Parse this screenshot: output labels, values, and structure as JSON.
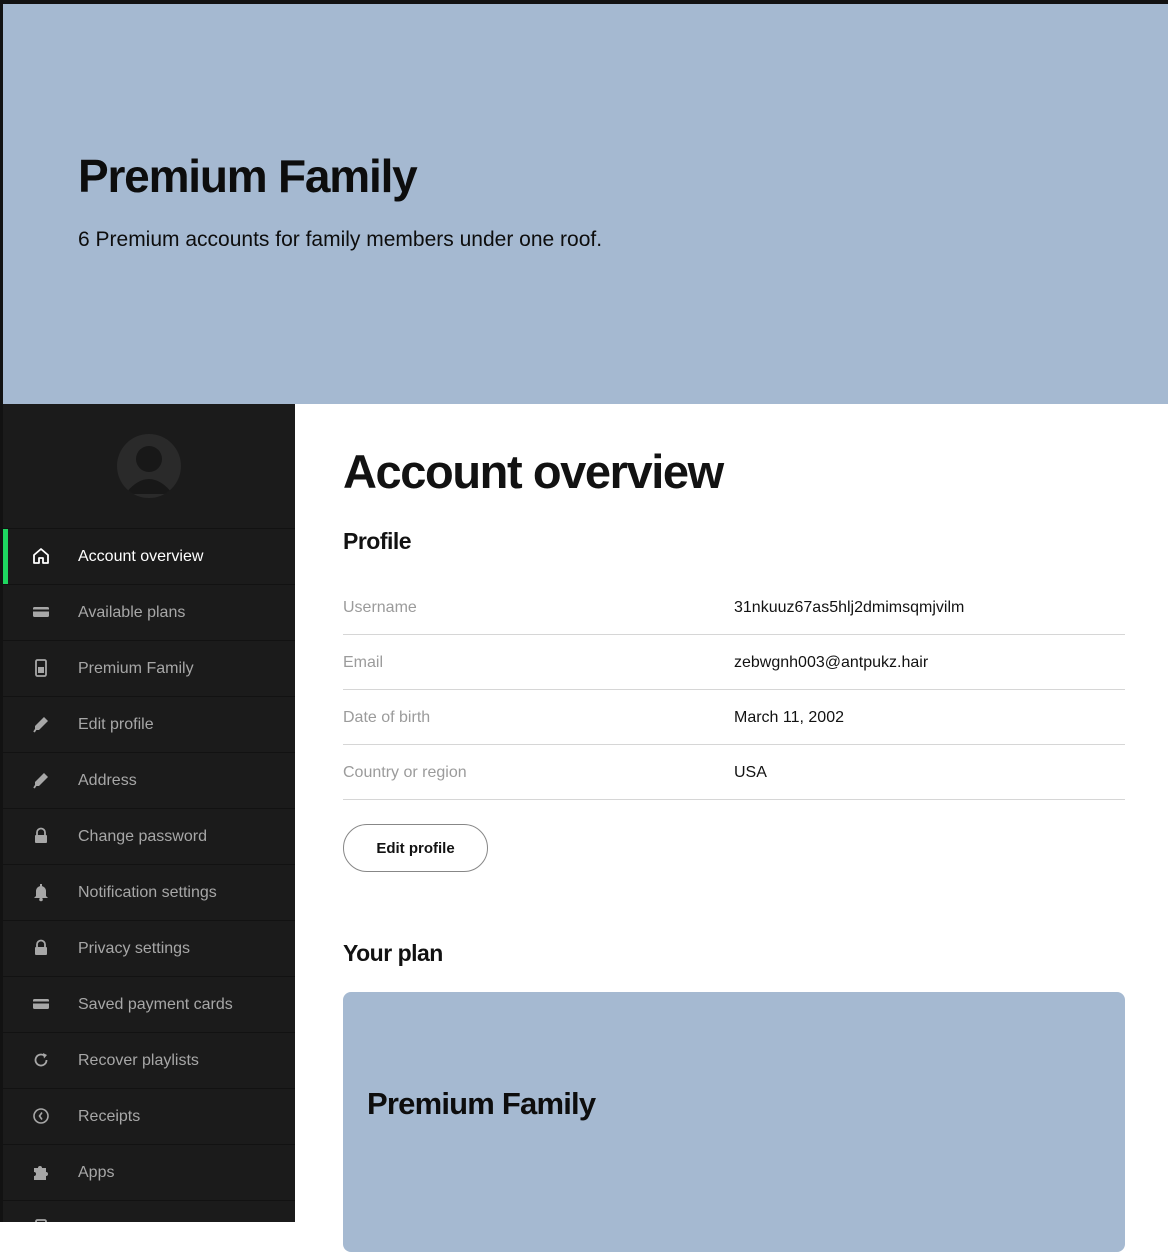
{
  "hero": {
    "title": "Premium Family",
    "subtitle": "6 Premium accounts for family members under one roof.",
    "background": "#a5b9d1"
  },
  "sidebar": {
    "accent_color": "#1ed760",
    "items": [
      {
        "label": "Account overview",
        "icon": "home-icon",
        "active": true
      },
      {
        "label": "Available plans",
        "icon": "card-icon"
      },
      {
        "label": "Premium Family",
        "icon": "device-icon"
      },
      {
        "label": "Edit profile",
        "icon": "pencil-icon"
      },
      {
        "label": "Address",
        "icon": "pencil-icon"
      },
      {
        "label": "Change password",
        "icon": "lock-icon"
      },
      {
        "label": "Notification settings",
        "icon": "bell-icon"
      },
      {
        "label": "Privacy settings",
        "icon": "lock-icon"
      },
      {
        "label": "Saved payment cards",
        "icon": "card-icon"
      },
      {
        "label": "Recover playlists",
        "icon": "refresh-icon"
      },
      {
        "label": "Receipts",
        "icon": "clock-icon"
      },
      {
        "label": "Apps",
        "icon": "puzzle-icon"
      },
      {
        "label": "",
        "icon": "device-icon"
      }
    ]
  },
  "main": {
    "title": "Account overview",
    "profile": {
      "heading": "Profile",
      "rows": [
        {
          "label": "Username",
          "value": "31nkuuz67as5hlj2dmimsqmjvilm"
        },
        {
          "label": "Email",
          "value": "zebwgnh003@antpukz.hair"
        },
        {
          "label": "Date of birth",
          "value": "March 11, 2002"
        },
        {
          "label": "Country or region",
          "value": "USA"
        }
      ],
      "edit_button": "Edit profile"
    },
    "plan": {
      "heading": "Your plan",
      "name": "Premium Family"
    }
  }
}
